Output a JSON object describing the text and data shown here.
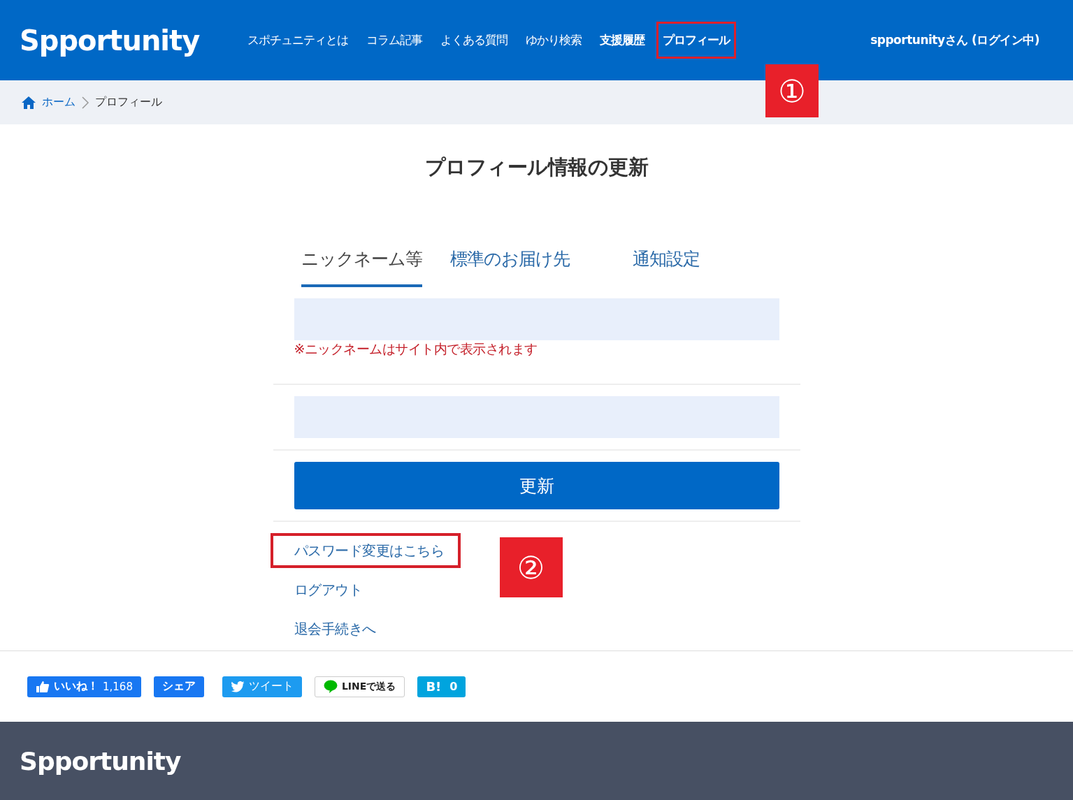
{
  "header": {
    "logo": "Spportunity",
    "nav": [
      {
        "label": "スポチュニティとは",
        "bold": false,
        "annotated": false
      },
      {
        "label": "コラム記事",
        "bold": false,
        "annotated": false
      },
      {
        "label": "よくある質問",
        "bold": false,
        "annotated": false
      },
      {
        "label": "ゆかり検索",
        "bold": false,
        "annotated": false
      },
      {
        "label": "支援履歴",
        "bold": true,
        "annotated": false
      },
      {
        "label": "プロフィール",
        "bold": true,
        "annotated": true
      }
    ],
    "user": "spportunityさん (ログイン中)"
  },
  "breadcrumb": {
    "items": [
      "ホーム",
      "プロフィール"
    ]
  },
  "page_title": "プロフィール情報の更新",
  "tabs": [
    {
      "label": "ニックネーム等",
      "selected": true
    },
    {
      "label": "標準のお届け先",
      "selected": false
    },
    {
      "label": "通知設定",
      "selected": false
    }
  ],
  "nickname_note": "※ニックネームはサイト内で表示されます",
  "submit_button": "更新",
  "links": [
    {
      "label": "パスワード変更はこちら",
      "annotated": true
    },
    {
      "label": "ログアウト",
      "annotated": false
    },
    {
      "label": "退会手続きへ",
      "annotated": false
    }
  ],
  "annotations": [
    "①",
    "②"
  ],
  "share": [
    {
      "kind": "like",
      "label": "いいね！",
      "count": "1,168"
    },
    {
      "kind": "share",
      "label": "シェア"
    },
    {
      "kind": "tweet",
      "label": "ツイート"
    },
    {
      "kind": "line",
      "label": "LINEで送る"
    },
    {
      "kind": "hatena",
      "label": "B!",
      "count": "0"
    }
  ],
  "footer": {
    "logo": "Spportunity"
  }
}
